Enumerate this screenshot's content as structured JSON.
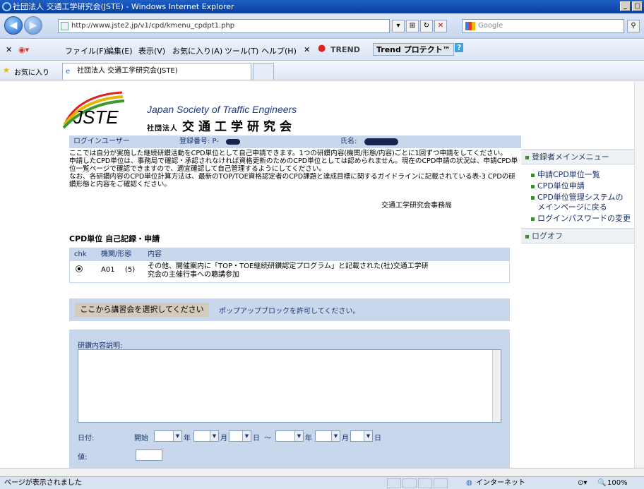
{
  "window": {
    "title": "社団法人 交通工学研究会(JSTE) - Windows Internet Explorer",
    "minimize": "_",
    "maximize": "□"
  },
  "address": {
    "url": "http://www.jste2.jp/v1/cpd/kmenu_cpdpt1.php",
    "search_placeholder": "Google"
  },
  "menubar": {
    "items": [
      "ファイル(F)",
      "編集(E)",
      "表示(V)",
      "お気に入り(A)",
      "ツール(T)",
      "ヘルプ(H)"
    ],
    "trend": "TREND",
    "trend_protect": "Trend プロテクト™"
  },
  "favorites": {
    "label": "お気に入り",
    "tab_title": "社団法人 交通工学研究会(JSTE)"
  },
  "banner": {
    "logo_text": "JSTE",
    "english_name": "Japan Society of Traffic Engineers",
    "corp_prefix": "社団法人",
    "japanese_name": "交通工学研究会"
  },
  "userbar": {
    "login_user_label": "ログインユーザー",
    "reg_no_label": "登録番号: P-",
    "name_label": "氏名:"
  },
  "intro": {
    "line1": "ここでは自分が実施した継続研鑽活動をCPD単位として自己申請できます。1つの研鑽内容(機関/形態/内容)ごとに1回ずつ申請をしてください。",
    "line2": "申請したCPD単位は、事務局で確認・承認されなければ資格更新のためのCPD単位としては認められません。現在のCPD申請の状況は、申請CPD単位一覧ページで確認できますので、適宜確認して自己管理するようにしてください。",
    "line3": "なお、各研鑽内容のCPD単位計算方法は、最新のTOP/TOE資格認定者のCPD課題と達成目標に関するガイドラインに記載されている表-3 CPDの研鑽形態と内容をご確認ください。",
    "office": "交通工学研究会事務局"
  },
  "cpd": {
    "title": "CPD単位 自己記録・申請",
    "headers": [
      "chk",
      "機関/形態",
      "内容"
    ],
    "row": {
      "code": "A01",
      "form": "(5)",
      "content": "その他、開催案内に「TOP・TOE継続研鑽認定プログラム」と記載された(社)交通工学研究会の主催行事への聴講参加"
    }
  },
  "select": {
    "button": "ここから講習会を選択してください",
    "note": "ポップアップブロックを許可してください。"
  },
  "form": {
    "description_label": "研鑽内容説明:",
    "date_label": "日付:",
    "start_label": "開始",
    "year": "年",
    "month": "月",
    "day": "日",
    "tilde": "～",
    "value_label": "値:"
  },
  "rightmenu": {
    "header": "登録者メインメニュー",
    "items": [
      "申請CPD単位一覧",
      "CPD単位申請",
      "CPD単位管理システムの",
      "メインページに戻る",
      "ログインパスワードの変更"
    ],
    "logoff": "ログオフ"
  },
  "status": {
    "text": "ページが表示されました",
    "zone": "インターネット",
    "zoom": "100%"
  }
}
